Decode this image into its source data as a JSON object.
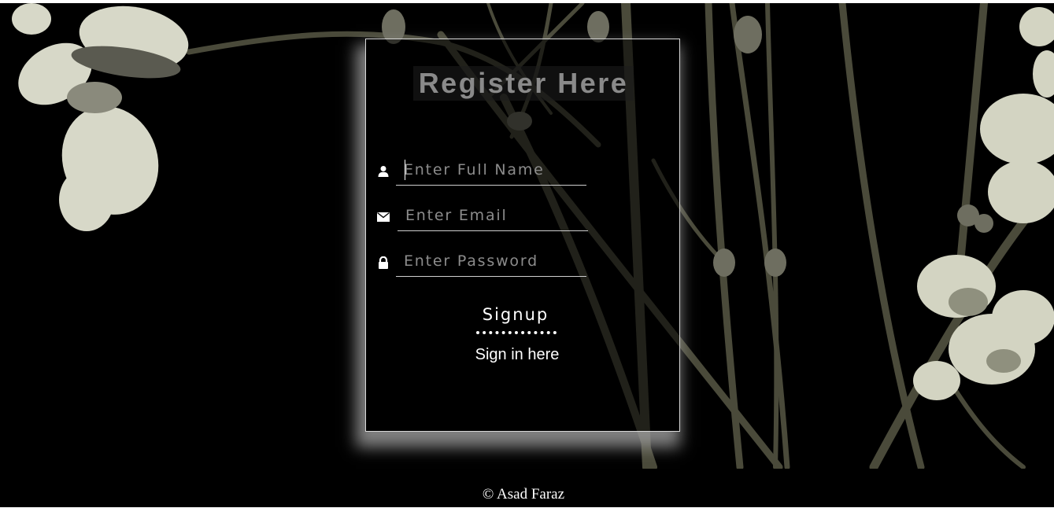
{
  "form": {
    "title": "Register Here",
    "fields": [
      {
        "icon": "user-icon",
        "placeholder": "Enter Full Name",
        "value": ""
      },
      {
        "icon": "envelope-icon",
        "placeholder": "Enter Email",
        "value": ""
      },
      {
        "icon": "lock-icon",
        "placeholder": "Enter Password",
        "value": ""
      }
    ],
    "signup_label": "Signup",
    "signin_label": "Sign in here"
  },
  "footer": {
    "text": "© Asad Faraz"
  },
  "colors": {
    "background": "#000000",
    "text": "#ffffff",
    "title": "#8a8a8a",
    "placeholder": "#8c8c8c",
    "card_border": "#d8d8d8"
  }
}
